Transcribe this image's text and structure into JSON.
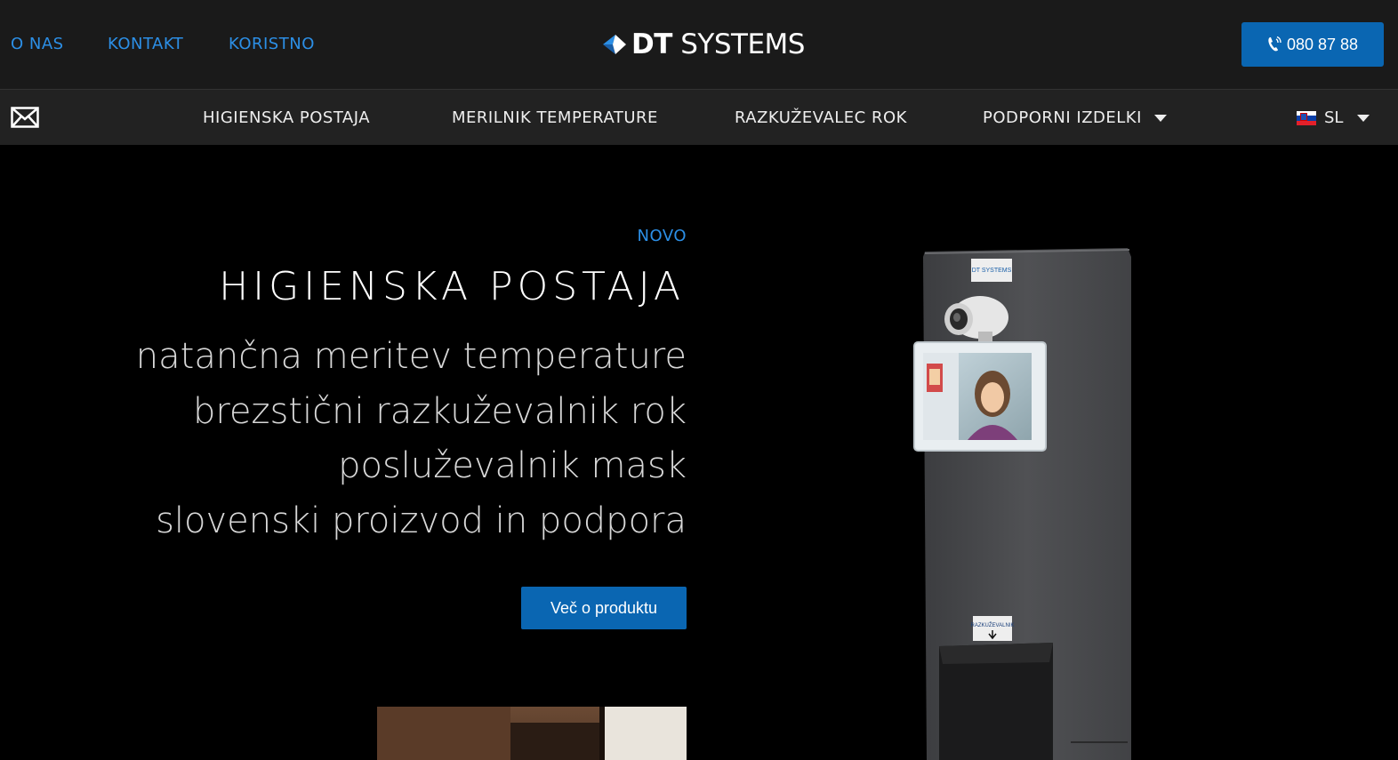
{
  "topbar": {
    "links": [
      "O NAS",
      "KONTAKT",
      "KORISTNO"
    ],
    "brand_bold": "DT",
    "brand_rest": " SYSTEMS",
    "phone": "080 87 88"
  },
  "nav": {
    "items": [
      "HIGIENSKA POSTAJA",
      "MERILNIK TEMPERATURE",
      "RAZKUŽEVALEC ROK",
      "PODPORNI IZDELKI"
    ],
    "language": "SL"
  },
  "hero": {
    "badge": "NOVO",
    "title": "HIGIENSKA POSTAJA",
    "features": [
      "natančna meritev temperature",
      "brezstični razkuževalnik rok",
      "posluževalnik mask",
      "slovenski proizvod in podpora"
    ],
    "cta_label": "Več o produktu"
  },
  "product_image": {
    "label_top": "DT SYSTEMS",
    "label_bottom": "RAZKUŽEVALNIK"
  },
  "colors": {
    "accent": "#2c8fe6",
    "button": "#0a66b2",
    "topbar_bg": "#1a1a1a",
    "nav_bg": "#222222",
    "hero_bg": "#000000"
  },
  "icons": [
    "logo-arrow-icon",
    "phone-icon",
    "mail-icon",
    "chevron-down-icon",
    "slovenia-flag-icon",
    "down-arrow-icon"
  ]
}
